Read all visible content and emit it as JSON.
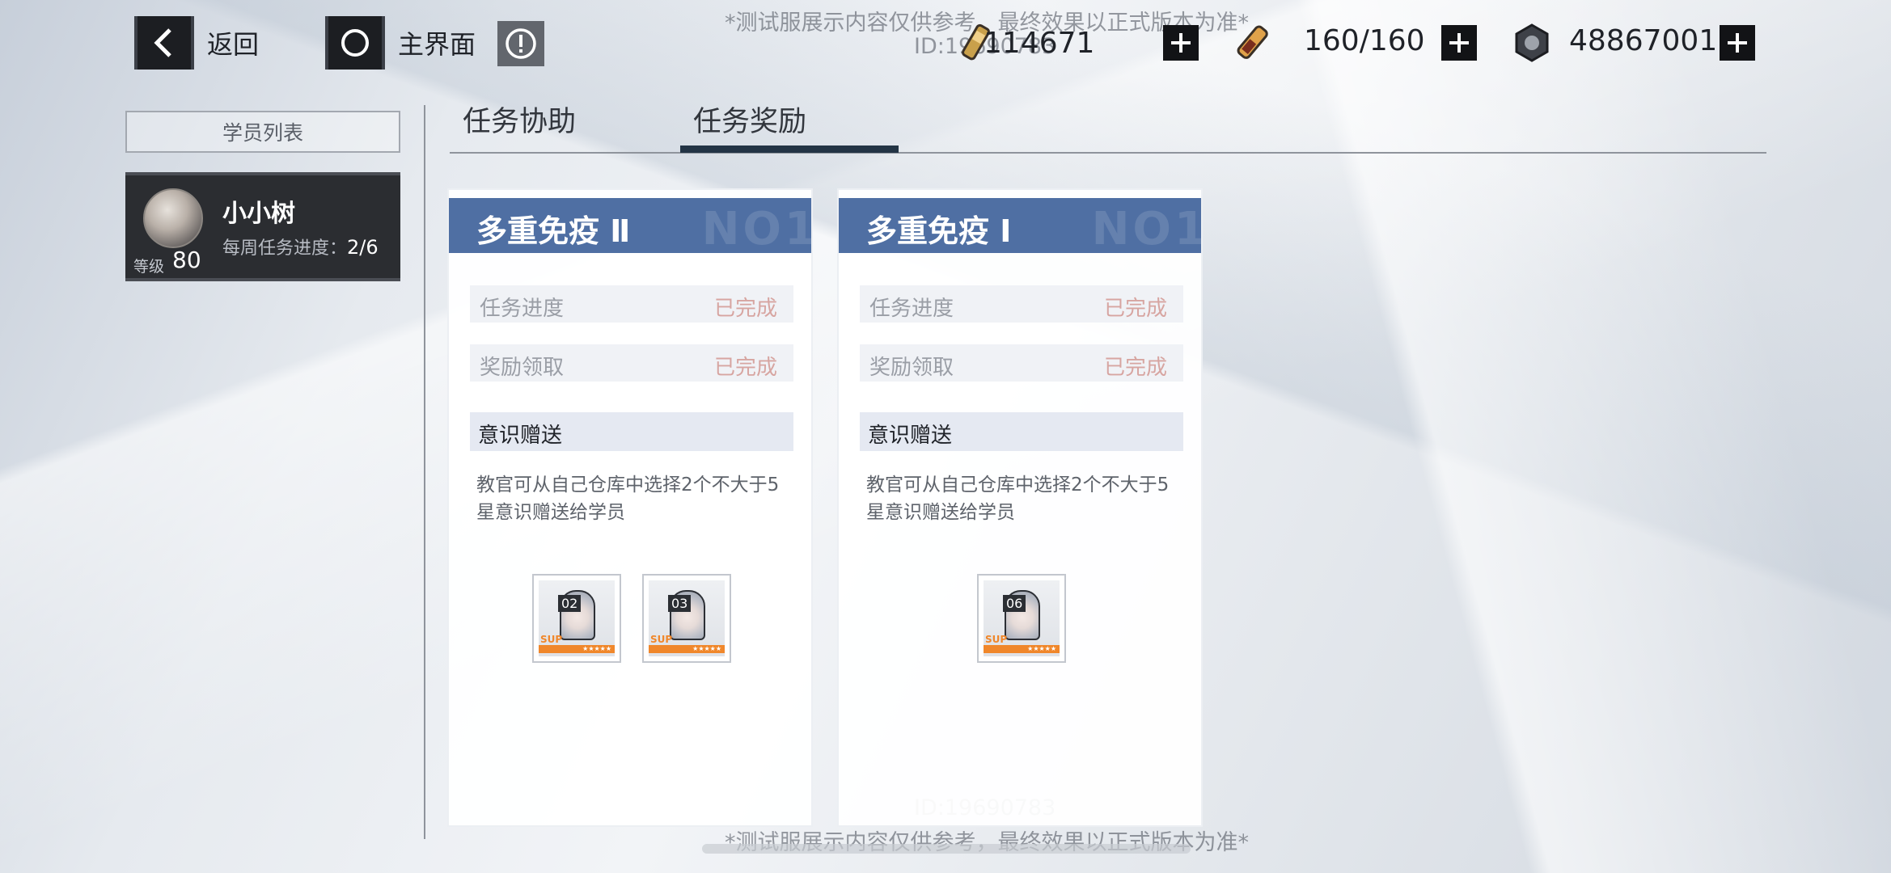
{
  "watermark": {
    "notice": "*测试服展示内容仅供参考，最终效果以正式版本为准*",
    "id_label": "ID:19690783"
  },
  "topbar": {
    "back_label": "返回",
    "home_label": "主界面",
    "resources": [
      {
        "icon": "stamina-item-icon",
        "value": "114671"
      },
      {
        "icon": "blood-vial-icon",
        "value": "160/160"
      },
      {
        "icon": "gear-nut-icon",
        "value": "48867001"
      }
    ]
  },
  "sidebar": {
    "header": "学员列表",
    "member": {
      "name": "小小树",
      "progress_label": "每周任务进度：",
      "progress_value": "2/6",
      "level_label": "等级",
      "level": "80"
    }
  },
  "tabs": [
    {
      "label": "任务协助",
      "active": false
    },
    {
      "label": "任务奖励",
      "active": true
    }
  ],
  "cards": [
    {
      "title": "多重免疫 Ⅱ",
      "rows": [
        {
          "label": "任务进度",
          "value": "已完成"
        },
        {
          "label": "奖励领取",
          "value": "已完成"
        }
      ],
      "section": "意识赠送",
      "description": "教官可从自己仓库中选择2个不大于5星意识赠送给学员",
      "items": [
        {
          "num": "02",
          "tag": "SUP"
        },
        {
          "num": "03",
          "tag": "SUP"
        }
      ]
    },
    {
      "title": "多重免疫 Ⅰ",
      "rows": [
        {
          "label": "任务进度",
          "value": "已完成"
        },
        {
          "label": "奖励领取",
          "value": "已完成"
        }
      ],
      "section": "意识赠送",
      "description": "教官可从自己仓库中选择2个不大于5星意识赠送给学员",
      "items": [
        {
          "num": "06",
          "tag": "SUP"
        }
      ]
    }
  ],
  "colors": {
    "card_header": "#4f6fa3",
    "completed_text": "#d7a5a1",
    "tab_active": "#233445",
    "item_bar": "#f0872b"
  }
}
